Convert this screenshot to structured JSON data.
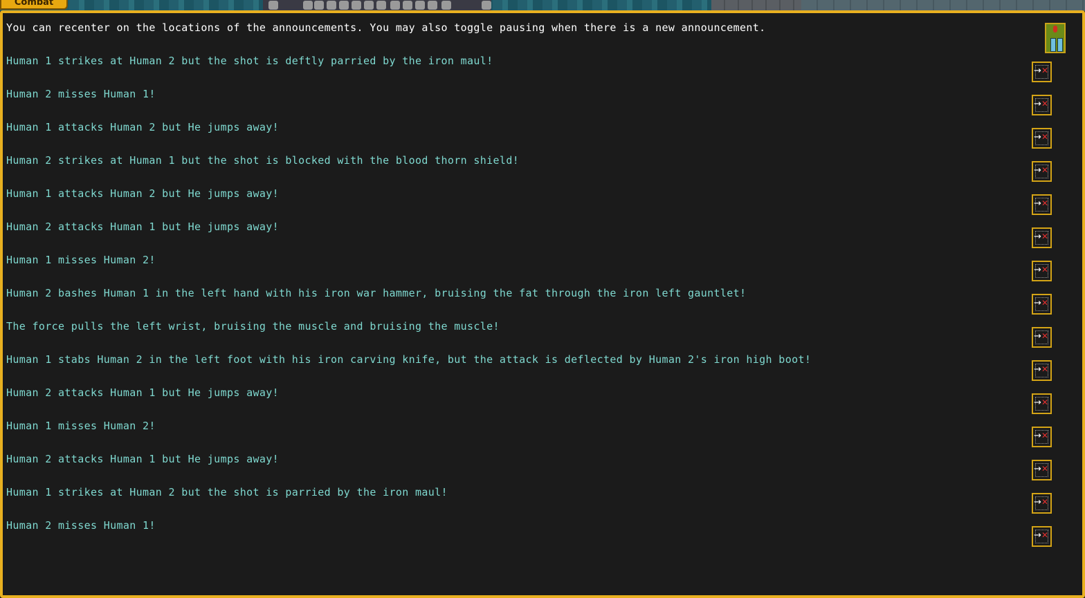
{
  "tab": {
    "label": "Combat"
  },
  "intro_text": "You can recenter on the locations of the announcements. You may also toggle pausing when there is a new announcement.",
  "icons": {
    "pause": "pause-toggle-icon",
    "recenter": "recenter-icon",
    "arrow_glyph": "→",
    "cross_glyph": "✕"
  },
  "colors": {
    "accent": "#e8b020",
    "message_text": "#7fd9d0",
    "intro_text": "#ffffff",
    "background": "#1b1b1b"
  },
  "messages": [
    "Human 1 strikes at Human 2 but the shot is deftly parried by the iron maul!",
    "Human 2 misses Human 1!",
    "Human 1 attacks Human 2 but He jumps away!",
    "Human 2 strikes at Human 1 but the shot is blocked with the blood thorn shield!",
    "Human 1 attacks Human 2 but He jumps away!",
    "Human 2 attacks Human 1 but He jumps away!",
    "Human 1 misses Human 2!",
    "Human 2 bashes Human 1 in the left hand with his iron war hammer, bruising the fat through the iron left gauntlet!",
    "The force pulls the left wrist, bruising the muscle and bruising the muscle!",
    "Human 1 stabs Human 2 in the left foot with his iron carving knife, but the attack is deflected by Human 2's iron high boot!",
    "Human 2 attacks Human 1 but He jumps away!",
    "Human 1 misses Human 2!",
    "Human 2 attacks Human 1 but He jumps away!",
    "Human 1 strikes at Human 2 but the shot is parried by the iron maul!",
    "Human 2 misses Human 1!"
  ]
}
